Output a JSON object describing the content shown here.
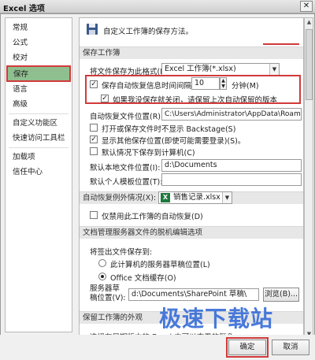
{
  "window": {
    "title": "Excel 选项",
    "close_glyph": "✕"
  },
  "sidebar": {
    "items": [
      {
        "label": "常规"
      },
      {
        "label": "公式"
      },
      {
        "label": "校对"
      },
      {
        "label": "保存"
      },
      {
        "label": "语言"
      },
      {
        "label": "高级"
      },
      {
        "label": "自定义功能区"
      },
      {
        "label": "快速访问工具栏"
      },
      {
        "label": "加载项"
      },
      {
        "label": "信任中心"
      }
    ],
    "selected_index": 3
  },
  "main": {
    "intro_text": "自定义工作簿的保存方法。",
    "section_save": "保存工作簿",
    "save_format_label": "将文件保存为此格式(F):",
    "save_format_value": "Excel 工作簿(*.xlsx)",
    "autorecover_label": "保存自动恢复信息时间间隔(A)",
    "autorecover_minutes": "10",
    "minutes_label": "分钟(M)",
    "keep_last_label": "如果我没保存就关闭，请保留上次自动保留的版本",
    "autorecover_location_label": "自动恢复文件位置(R):",
    "autorecover_location_value": "C:\\Users\\Administrator\\AppData\\Roaming\\",
    "no_backstage_label": "打开或保存文件时不显示 Backstage(S)",
    "show_other_locations_label": "显示其他保存位置(即使可能需要登录)(S)。",
    "default_to_computer_label": "默认情况下保存到计算机(C)",
    "default_local_label": "默认本地文件位置(I):",
    "default_local_value": "d:\\Documents",
    "default_template_label": "默认个人模板位置(T):",
    "default_template_value": "",
    "section_exceptions": "自动恢复例外情况(X):",
    "exception_workbook": "销售记录.xlsx",
    "disable_autorecover_label": "仅禁用此工作簿的自动恢复(D)",
    "section_offline": "文档管理服务器文件的脱机编辑选项",
    "save_checked_out_label": "将签出文件保存到:",
    "server_drafts_label": "此计算机的服务器草稿位置(L)",
    "office_cache_label": "Office 文档缓存(O)",
    "server_drafts_location_label": "服务器草稿位置(V):",
    "server_drafts_location_value": "d:\\Documents\\SharePoint 草稿\\",
    "browse_label": "浏览(B)...",
    "section_appearance": "保留工作簿的外观",
    "appearance_text": "选择在早期版本的 Excel 中可以查看的颜色:"
  },
  "footer": {
    "ok_label": "确定",
    "cancel_label": "取消"
  },
  "watermark": "极速下载站",
  "colors": {
    "accent_red": "#d13a3a",
    "selected_green": "#8fbf8f",
    "excel_green": "#1e7a3c"
  },
  "icons": {
    "save": "floppy-disk-icon",
    "excel_file": "excel-file-icon"
  }
}
